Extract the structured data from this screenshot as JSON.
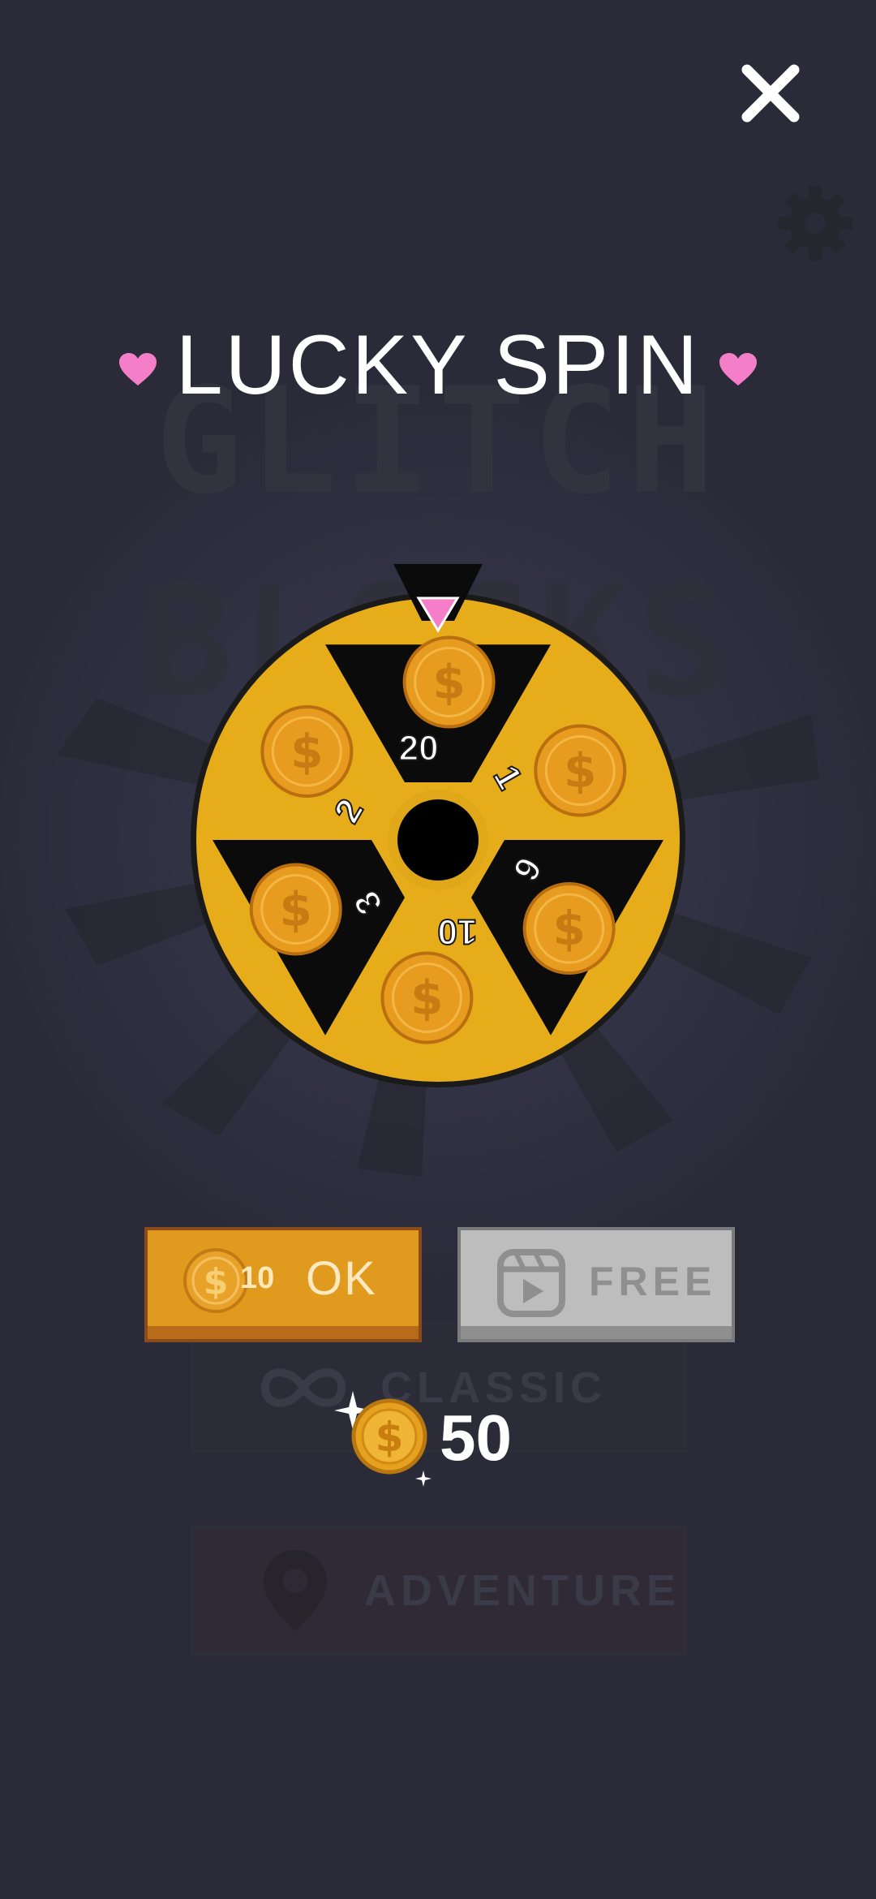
{
  "background": {
    "logo_line1": "GLITCH",
    "logo_line2": "BLOCKS",
    "menu": [
      {
        "label": "CLASSIC"
      },
      {
        "label": "ADVENTURE"
      }
    ]
  },
  "header": {
    "title": "LUCKY SPIN",
    "close_icon": "close-icon"
  },
  "wheel": {
    "segments": [
      {
        "value": "20"
      },
      {
        "value": "1"
      },
      {
        "value": "6"
      },
      {
        "value": "10"
      },
      {
        "value": "3"
      },
      {
        "value": "2"
      }
    ]
  },
  "actions": {
    "ok_cost": "10",
    "ok_label": "OK",
    "free_label": "FREE"
  },
  "wallet": {
    "coins": "50"
  },
  "colors": {
    "background": "#2a2a38",
    "wheel_gold": "#e6ac1a",
    "heart": "#f47fc8",
    "ok_button": "#e09a1e",
    "free_button": "#bdbdbd"
  }
}
